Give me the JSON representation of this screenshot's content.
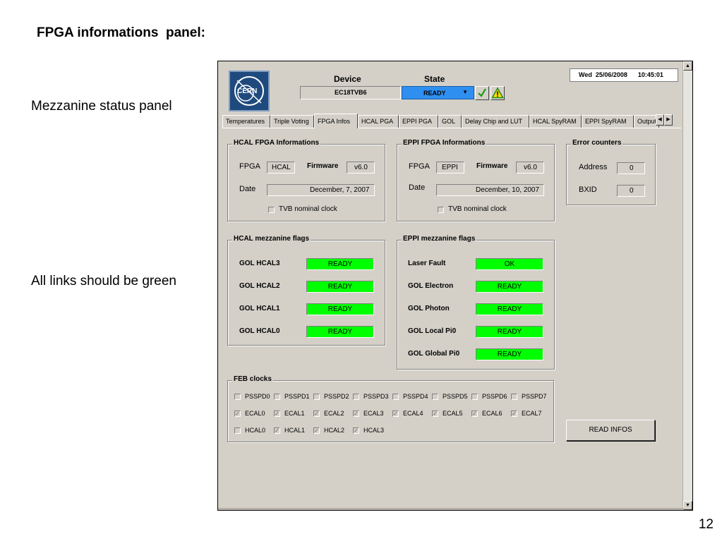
{
  "slide": {
    "title": "FPGA informations  panel:",
    "note_top": "Mezzanine status panel",
    "note_bottom": "All links should be green",
    "page_number": "12"
  },
  "header": {
    "logo_text": "CERN",
    "device_label": "Device",
    "device_value": "EC18TVB6",
    "state_label": "State",
    "state_value": "READY",
    "datetime": "Wed  25/06/2008      10:45:01",
    "ok_icon": "check-icon",
    "warn_icon": "warning-icon"
  },
  "tabs": [
    {
      "label": "Temperatures"
    },
    {
      "label": "Triple Voting"
    },
    {
      "label": "FPGA Infos"
    },
    {
      "label": "HCAL PGA"
    },
    {
      "label": "EPPI PGA"
    },
    {
      "label": "GOL"
    },
    {
      "label": "Delay Chip and LUT"
    },
    {
      "label": "HCAL SpyRAM"
    },
    {
      "label": "EPPI SpyRAM"
    },
    {
      "label": "Output"
    }
  ],
  "active_tab": "FPGA Infos",
  "hcal_fpga": {
    "title": "HCAL FPGA Informations",
    "fpga_label": "FPGA",
    "fpga_value": "HCAL",
    "firmware_label": "Firmware",
    "firmware_value": "v6.0",
    "date_label": "Date",
    "date_value": "December, 7, 2007",
    "tvb_label": "TVB nominal clock"
  },
  "eppi_fpga": {
    "title": "EPPI FPGA Informations",
    "fpga_label": "FPGA",
    "fpga_value": "EPPI",
    "firmware_label": "Firmware",
    "firmware_value": "v6.0",
    "date_label": "Date",
    "date_value": "December, 10, 2007",
    "tvb_label": "TVB nominal clock"
  },
  "error_counters": {
    "title": "Error counters",
    "address_label": "Address",
    "address_value": "0",
    "bxid_label": "BXID",
    "bxid_value": "0"
  },
  "hcal_flags": {
    "title": "HCAL mezzanine flags",
    "items": [
      {
        "label": "GOL HCAL3",
        "value": "READY"
      },
      {
        "label": "GOL HCAL2",
        "value": "READY"
      },
      {
        "label": "GOL HCAL1",
        "value": "READY"
      },
      {
        "label": "GOL HCAL0",
        "value": "READY"
      }
    ]
  },
  "eppi_flags": {
    "title": "EPPI mezzanine flags",
    "items": [
      {
        "label": "Laser Fault",
        "value": "OK"
      },
      {
        "label": "GOL Electron",
        "value": "READY"
      },
      {
        "label": "GOL Photon",
        "value": "READY"
      },
      {
        "label": "GOL Local Pi0",
        "value": "READY"
      },
      {
        "label": "GOL Global Pi0",
        "value": "READY"
      }
    ]
  },
  "flag_color": "#00ff00",
  "feb_clocks": {
    "title": "FEB clocks",
    "rows": [
      [
        {
          "label": "PSSPD0",
          "checked": false
        },
        {
          "label": "PSSPD1",
          "checked": false
        },
        {
          "label": "PSSPD2",
          "checked": false
        },
        {
          "label": "PSSPD3",
          "checked": false
        },
        {
          "label": "PSSPD4",
          "checked": false
        },
        {
          "label": "PSSPD5",
          "checked": false
        },
        {
          "label": "PSSPD6",
          "checked": false
        },
        {
          "label": "PSSPD7",
          "checked": false
        }
      ],
      [
        {
          "label": "ECAL0",
          "checked": true
        },
        {
          "label": "ECAL1",
          "checked": true
        },
        {
          "label": "ECAL2",
          "checked": true
        },
        {
          "label": "ECAL3",
          "checked": true
        },
        {
          "label": "ECAL4",
          "checked": true
        },
        {
          "label": "ECAL5",
          "checked": true
        },
        {
          "label": "ECAL6",
          "checked": true
        },
        {
          "label": "ECAL7",
          "checked": true
        }
      ],
      [
        {
          "label": "HCAL0",
          "checked": false
        },
        {
          "label": "HCAL1",
          "checked": true
        },
        {
          "label": "HCAL2",
          "checked": true
        },
        {
          "label": "HCAL3",
          "checked": true
        }
      ]
    ]
  },
  "read_button": "READ INFOS"
}
